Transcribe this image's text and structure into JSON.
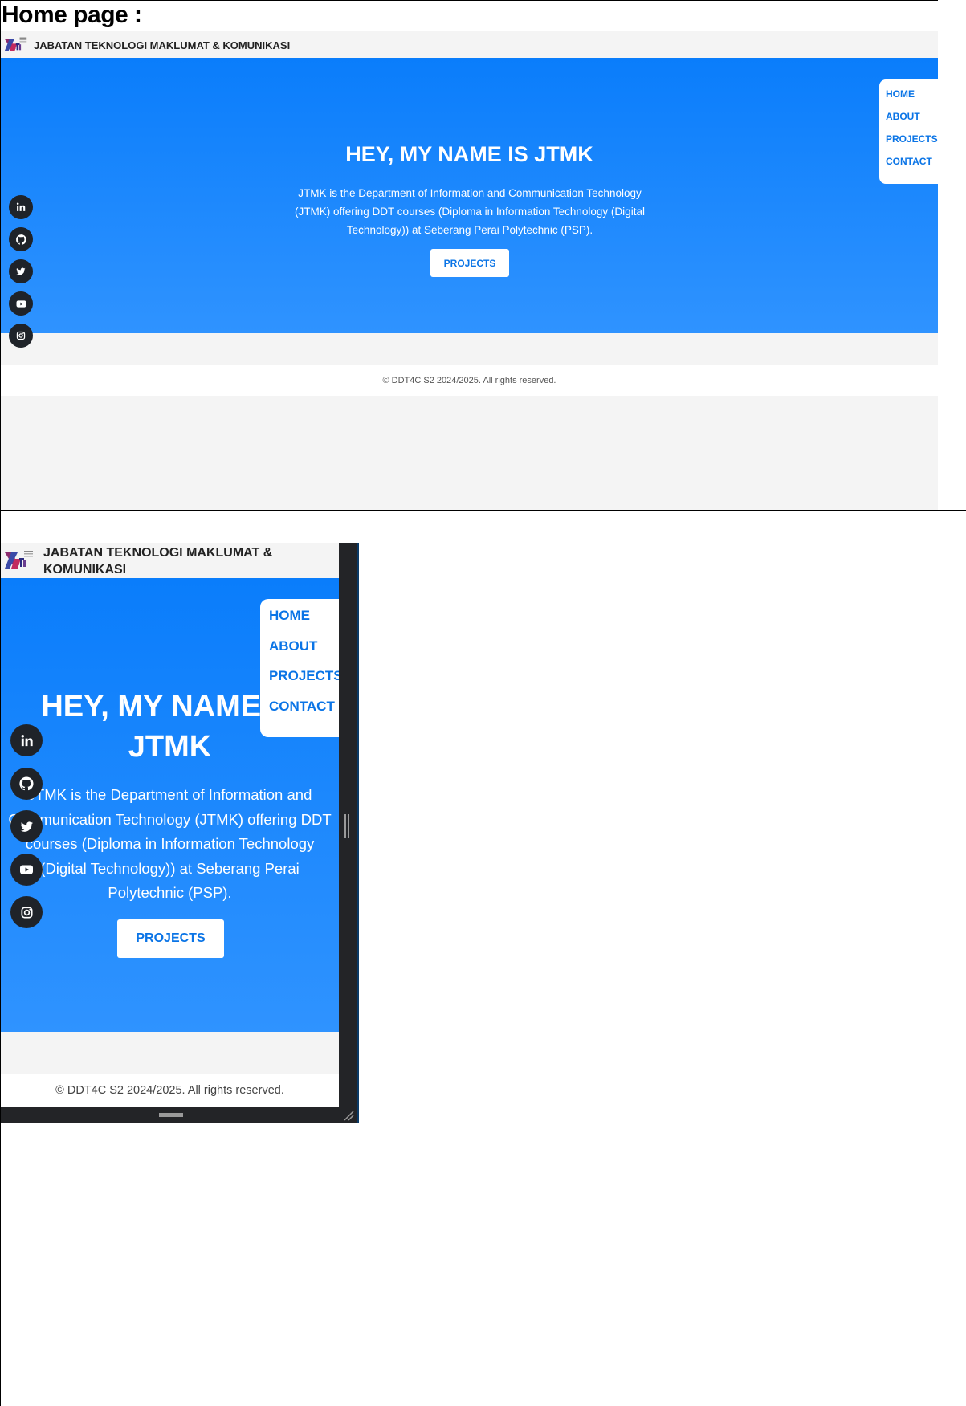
{
  "document": {
    "title": "Home page :"
  },
  "site": {
    "brand": "JABATAN TEKNOLOGI MAKLUMAT & KOMUNIKASI",
    "logo_text": "JABATAN TEKNOLOGI",
    "nav": [
      "HOME",
      "ABOUT",
      "PROJECTS",
      "CONTACT"
    ],
    "hero": {
      "title": "HEY, MY NAME IS JTMK",
      "description": "JTMK is the Department of Information and Communication Technology (JTMK) offering DDT courses (Diploma in Information Technology (Digital Technology)) at Seberang Perai Polytechnic (PSP).",
      "button_label": "PROJECTS"
    },
    "social": [
      {
        "icon": "linkedin-icon"
      },
      {
        "icon": "github-icon"
      },
      {
        "icon": "twitter-icon"
      },
      {
        "icon": "youtube-icon"
      },
      {
        "icon": "instagram-icon"
      }
    ],
    "footer": "© DDT4C S2 2024/2025. All rights reserved."
  },
  "colors": {
    "hero_top": "#0a7dfb",
    "hero_bottom": "#2f93ff",
    "accent": "#0a74e6",
    "social_bg": "#1f2329",
    "page_bg": "#f4f4f4"
  }
}
